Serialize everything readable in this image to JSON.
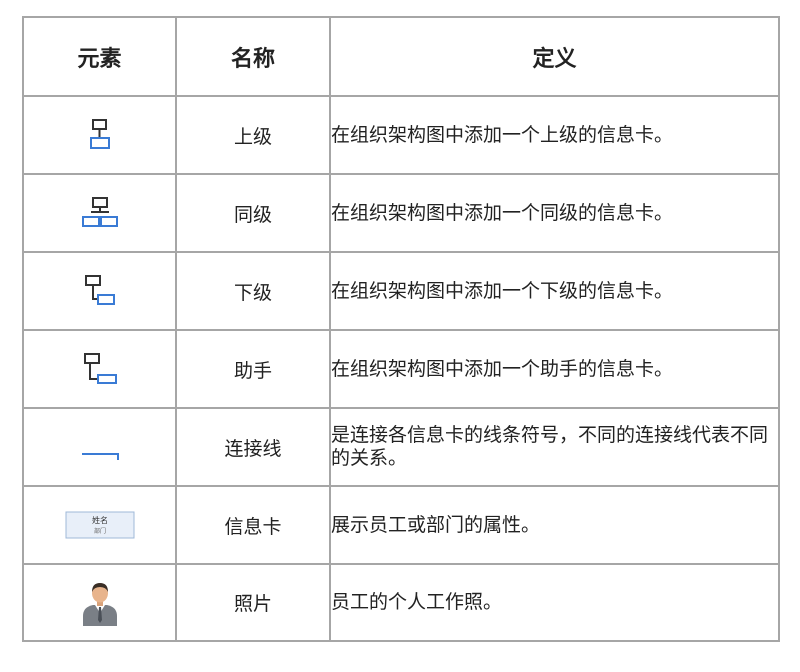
{
  "table": {
    "headers": [
      "元素",
      "名称",
      "定义"
    ],
    "rows": [
      {
        "icon": "superior-card-icon",
        "name": "上级",
        "definition": "在组织架构图中添加一个上级的信息卡。"
      },
      {
        "icon": "sibling-card-icon",
        "name": "同级",
        "definition": "在组织架构图中添加一个同级的信息卡。"
      },
      {
        "icon": "subordinate-card-icon",
        "name": "下级",
        "definition": "在组织架构图中添加一个下级的信息卡。"
      },
      {
        "icon": "assistant-card-icon",
        "name": "助手",
        "definition": "在组织架构图中添加一个助手的信息卡。"
      },
      {
        "icon": "connector-line-icon",
        "name": "连接线",
        "definition": "是连接各信息卡的线条符号，不同的连接线代表不同的关系。"
      },
      {
        "icon": "info-card-icon",
        "name": "信息卡",
        "definition": "展示员工或部门的属性。",
        "icon_text": {
          "name": "姓名",
          "dept": "部门"
        }
      },
      {
        "icon": "photo-person-icon",
        "name": "照片",
        "definition": "员工的个人工作照。"
      }
    ]
  },
  "colors": {
    "icon_blue": "#3a7bd5",
    "border": "#a6a6a6"
  }
}
